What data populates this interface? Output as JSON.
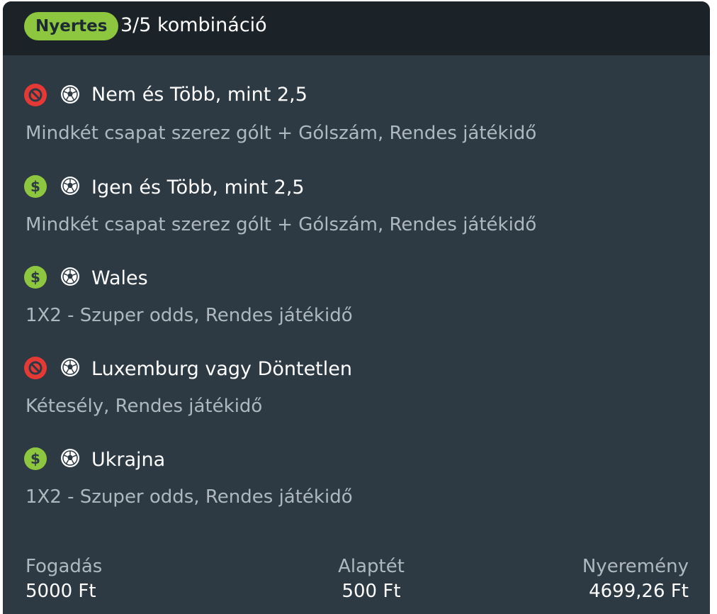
{
  "header": {
    "badge": "Nyertes",
    "title": "3/5 kombináció"
  },
  "selections": [
    {
      "status": "lost",
      "status_icon": "lost-icon",
      "sport_icon": "soccer-ball-icon",
      "title": "Nem és Több, mint 2,5",
      "subtitle": "Mindkét csapat szerez gólt + Gólszám, Rendes játékidő"
    },
    {
      "status": "won",
      "status_icon": "dollar-icon",
      "sport_icon": "soccer-ball-icon",
      "title": "Igen és Több, mint 2,5",
      "subtitle": "Mindkét csapat szerez gólt + Gólszám, Rendes játékidő"
    },
    {
      "status": "won",
      "status_icon": "dollar-icon",
      "sport_icon": "soccer-ball-icon",
      "title": "Wales",
      "subtitle": "1X2 - Szuper odds, Rendes játékidő"
    },
    {
      "status": "lost",
      "status_icon": "lost-icon",
      "sport_icon": "soccer-ball-icon",
      "title": "Luxemburg vagy Döntetlen",
      "subtitle": "Kétesély, Rendes játékidő"
    },
    {
      "status": "won",
      "status_icon": "dollar-icon",
      "sport_icon": "soccer-ball-icon",
      "title": "Ukrajna",
      "subtitle": "1X2 - Szuper odds, Rendes játékidő"
    }
  ],
  "footer": {
    "stake_label": "Fogadás",
    "stake_value": "5000 Ft",
    "base_stake_label": "Alaptét",
    "base_stake_value": "500 Ft",
    "winnings_label": "Nyeremény",
    "winnings_value": "4699,26 Ft"
  },
  "colors": {
    "card_bg": "#2d3a44",
    "header_bg": "#1c2328",
    "won": "#8dc63f",
    "lost": "#e53935",
    "secondary_text": "#aeb8bf"
  }
}
